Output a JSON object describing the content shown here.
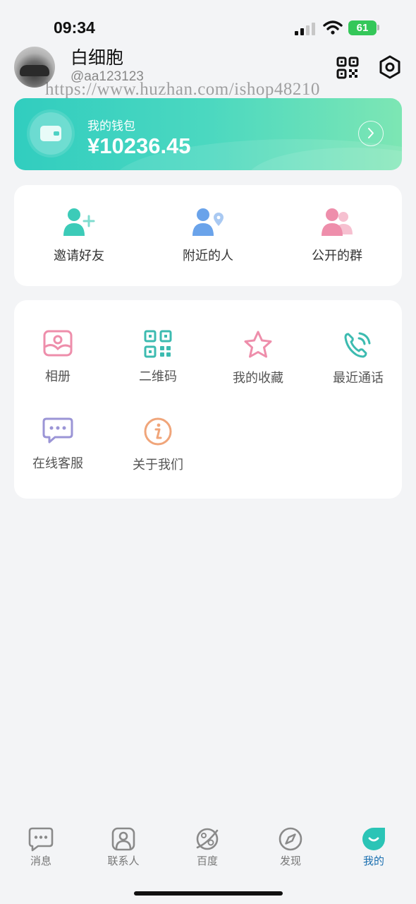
{
  "status_bar": {
    "time": "09:34",
    "battery": "61"
  },
  "profile": {
    "nickname": "白细胞",
    "user_id": "@aa123123"
  },
  "watermark": "https://www.huzhan.com/ishop48210",
  "wallet": {
    "title": "我的钱包",
    "amount": "¥10236.45"
  },
  "quick_actions": [
    {
      "label": "邀请好友",
      "icon": "add-user-icon"
    },
    {
      "label": "附近的人",
      "icon": "nearby-people-icon"
    },
    {
      "label": "公开的群",
      "icon": "public-group-icon"
    }
  ],
  "menu": [
    {
      "label": "相册",
      "icon": "photo-album-icon"
    },
    {
      "label": "二维码",
      "icon": "qr-code-icon"
    },
    {
      "label": "我的收藏",
      "icon": "star-icon"
    },
    {
      "label": "最近通话",
      "icon": "phone-icon"
    },
    {
      "label": "在线客服",
      "icon": "chat-bubble-icon"
    },
    {
      "label": "关于我们",
      "icon": "info-icon"
    }
  ],
  "tabs": [
    {
      "label": "消息",
      "icon": "message-icon"
    },
    {
      "label": "联系人",
      "icon": "contacts-icon"
    },
    {
      "label": "百度",
      "icon": "planet-icon"
    },
    {
      "label": "发现",
      "icon": "compass-icon"
    },
    {
      "label": "我的",
      "icon": "me-icon",
      "active": true
    }
  ],
  "colors": {
    "accent": "#1a6fb0",
    "wallet_gradient_start": "#31cdbf",
    "wallet_gradient_end": "#7de6b4",
    "teal_icon": "#3ccbb8",
    "pink_icon": "#ee8eab",
    "blue_icon": "#6aa3ea"
  }
}
